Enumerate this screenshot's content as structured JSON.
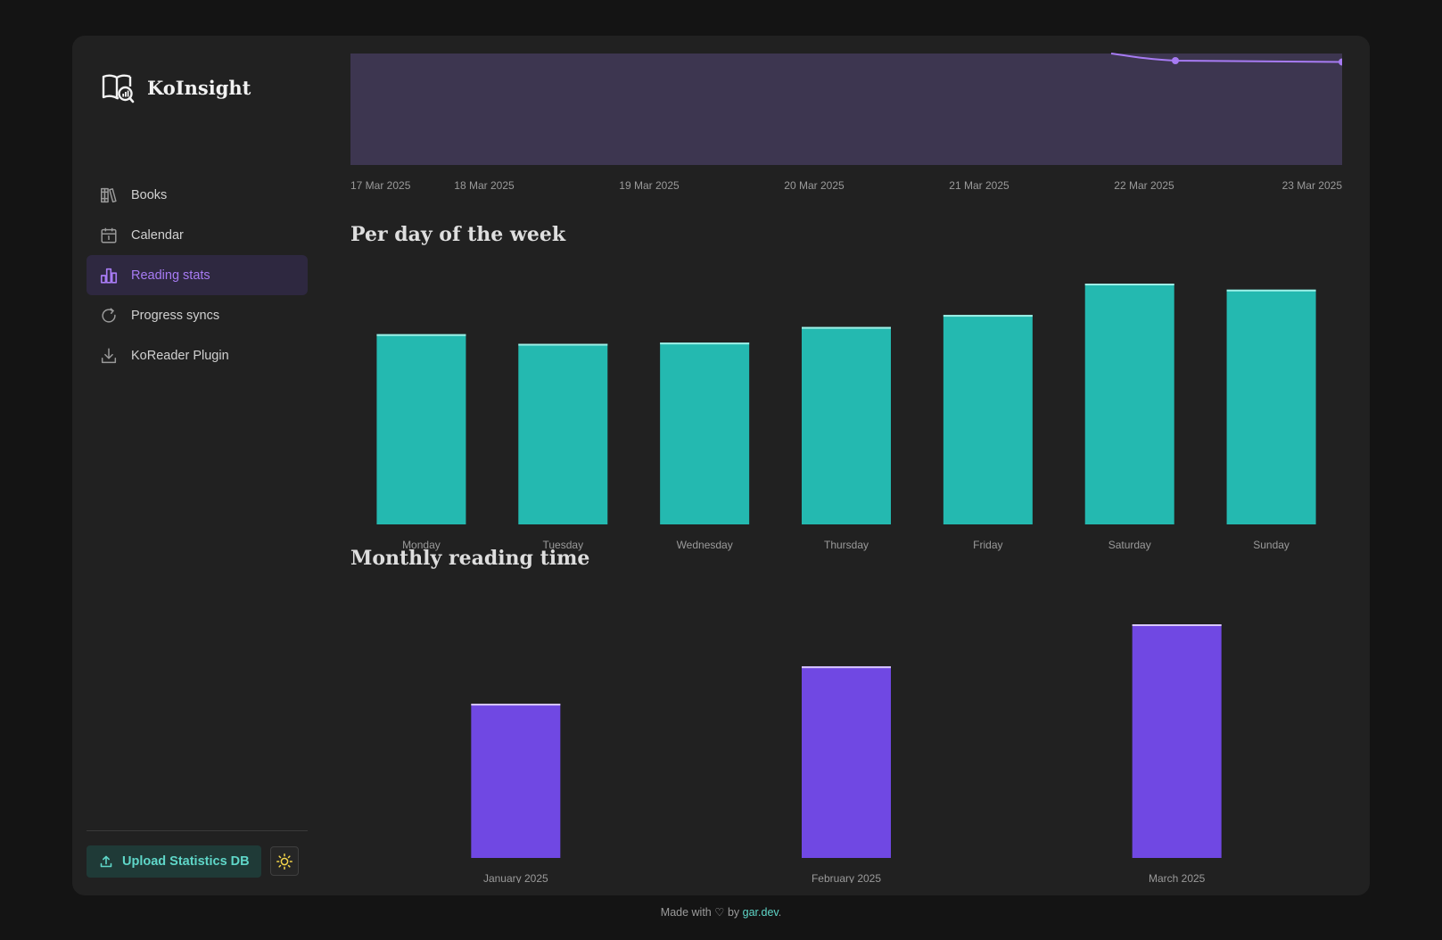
{
  "app": {
    "name": "KoInsight"
  },
  "nav": {
    "items": [
      {
        "label": "Books",
        "icon": "books-icon",
        "active": false
      },
      {
        "label": "Calendar",
        "icon": "calendar-icon",
        "active": false
      },
      {
        "label": "Reading stats",
        "icon": "bar-chart-icon",
        "active": true
      },
      {
        "label": "Progress syncs",
        "icon": "refresh-icon",
        "active": false
      },
      {
        "label": "KoReader Plugin",
        "icon": "download-icon",
        "active": false
      }
    ]
  },
  "sidebar_bottom": {
    "upload_label": "Upload Statistics DB",
    "upload_icon": "upload-icon",
    "theme_icon": "sun-icon"
  },
  "footer": {
    "prefix": "Made with",
    "heart": "♡",
    "by": "by",
    "link": "gar.dev",
    "suffix": "."
  },
  "colors": {
    "accent": "#a77bf3",
    "teal": "#24b9b0",
    "purple": "#7048e3",
    "area": "#3d3650"
  },
  "sections": {
    "weekday_title": "Per day of the week",
    "monthly_title": "Monthly reading time"
  },
  "chart_data": [
    {
      "type": "area",
      "x": [
        "17 Mar 2025",
        "18 Mar 2025",
        "19 Mar 2025",
        "20 Mar 2025",
        "21 Mar 2025",
        "22 Mar 2025",
        "23 Mar 2025"
      ],
      "tick_labels": [
        "17 Mar 2025",
        "18 Mar 2025",
        "19 Mar 2025",
        "20 Mar 2025",
        "21 Mar 2025",
        "22 Mar 2025",
        "23 Mar 2025"
      ],
      "note_visible": "chart partially scrolled; only tail of line visible near top",
      "grid": false
    },
    {
      "type": "bar",
      "categories": [
        "Monday",
        "Tuesday",
        "Wednesday",
        "Thursday",
        "Friday",
        "Saturday",
        "Sunday"
      ],
      "values": [
        79,
        75,
        75.5,
        82,
        87,
        100,
        97.5
      ],
      "color": "#24b9b0",
      "ylim": [
        0,
        100
      ],
      "grid": false
    },
    {
      "type": "bar",
      "categories": [
        "January 2025",
        "February 2025",
        "March 2025"
      ],
      "values": [
        66,
        82,
        100
      ],
      "color": "#7048e3",
      "ylim": [
        0,
        100
      ],
      "grid": false
    }
  ]
}
